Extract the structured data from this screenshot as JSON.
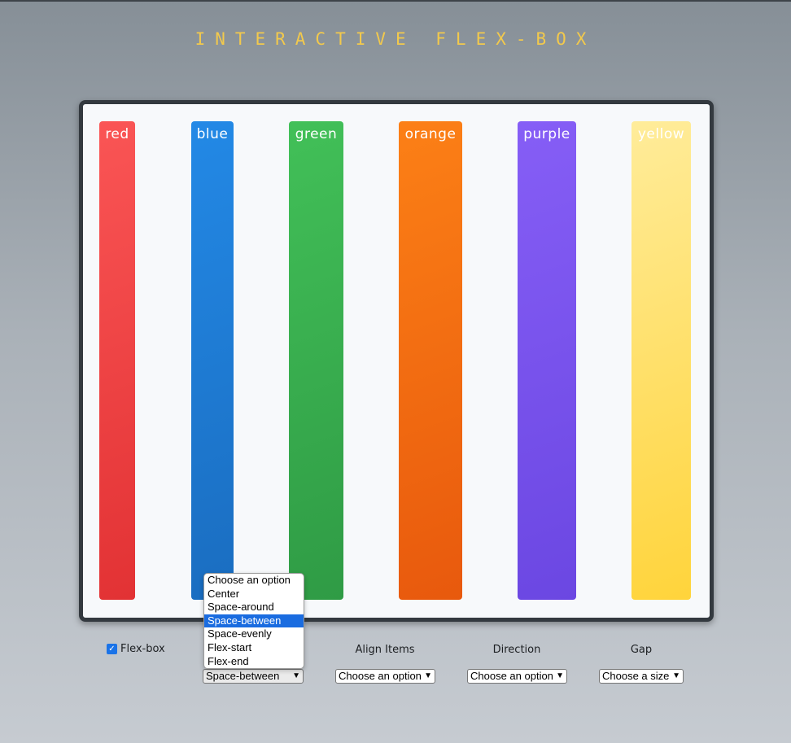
{
  "title": "INTERACTIVE FLEX-BOX",
  "columns": [
    {
      "label": "red"
    },
    {
      "label": "blue"
    },
    {
      "label": "green"
    },
    {
      "label": "orange"
    },
    {
      "label": "purple"
    },
    {
      "label": "yellow"
    }
  ],
  "controls": {
    "flexbox": {
      "label": "Flex-box",
      "checked": true
    },
    "justify": {
      "selected": "Space-between",
      "options": [
        "Choose an option",
        "Center",
        "Space-around",
        "Space-between",
        "Space-evenly",
        "Flex-start",
        "Flex-end"
      ]
    },
    "align_items": {
      "label": "Align Items",
      "selected": "Choose an option"
    },
    "direction": {
      "label": "Direction",
      "selected": "Choose an option"
    },
    "gap": {
      "label": "Gap",
      "selected": "Choose a size"
    }
  },
  "colors": {
    "title": "#f2c94c",
    "frame_border": "#33393f",
    "highlight": "#1a6ce0"
  }
}
